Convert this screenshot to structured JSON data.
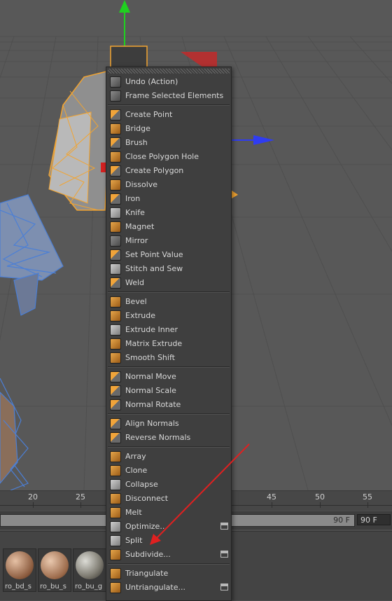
{
  "menu": {
    "groups": [
      [
        {
          "label": "Undo (Action)",
          "icon": "undo-icon",
          "style": "gray"
        },
        {
          "label": "Frame Selected Elements",
          "icon": "frame-selected-icon",
          "style": "gray"
        }
      ],
      [
        {
          "label": "Create Point",
          "icon": "create-point-icon",
          "style": "mix"
        },
        {
          "label": "Bridge",
          "icon": "bridge-icon",
          "style": "orange"
        },
        {
          "label": "Brush",
          "icon": "brush-icon",
          "style": "mix"
        },
        {
          "label": "Close Polygon Hole",
          "icon": "close-polygon-hole-icon",
          "style": "orange"
        },
        {
          "label": "Create Polygon",
          "icon": "create-polygon-icon",
          "style": "mix"
        },
        {
          "label": "Dissolve",
          "icon": "dissolve-icon",
          "style": "orange"
        },
        {
          "label": "Iron",
          "icon": "iron-icon",
          "style": "mix"
        },
        {
          "label": "Knife",
          "icon": "knife-icon",
          "style": "light"
        },
        {
          "label": "Magnet",
          "icon": "magnet-icon",
          "style": "orange"
        },
        {
          "label": "Mirror",
          "icon": "mirror-icon",
          "style": "gray"
        },
        {
          "label": "Set Point Value",
          "icon": "set-point-value-icon",
          "style": "mix"
        },
        {
          "label": "Stitch and Sew",
          "icon": "stitch-and-sew-icon",
          "style": "light"
        },
        {
          "label": "Weld",
          "icon": "weld-icon",
          "style": "mix"
        }
      ],
      [
        {
          "label": "Bevel",
          "icon": "bevel-icon",
          "style": "orange"
        },
        {
          "label": "Extrude",
          "icon": "extrude-icon",
          "style": "orange"
        },
        {
          "label": "Extrude Inner",
          "icon": "extrude-inner-icon",
          "style": "light"
        },
        {
          "label": "Matrix Extrude",
          "icon": "matrix-extrude-icon",
          "style": "orange"
        },
        {
          "label": "Smooth Shift",
          "icon": "smooth-shift-icon",
          "style": "orange"
        }
      ],
      [
        {
          "label": "Normal Move",
          "icon": "normal-move-icon",
          "style": "mix"
        },
        {
          "label": "Normal Scale",
          "icon": "normal-scale-icon",
          "style": "mix"
        },
        {
          "label": "Normal Rotate",
          "icon": "normal-rotate-icon",
          "style": "mix"
        }
      ],
      [
        {
          "label": "Align Normals",
          "icon": "align-normals-icon",
          "style": "mix"
        },
        {
          "label": "Reverse Normals",
          "icon": "reverse-normals-icon",
          "style": "mix"
        }
      ],
      [
        {
          "label": "Array",
          "icon": "array-icon",
          "style": "orange"
        },
        {
          "label": "Clone",
          "icon": "clone-icon",
          "style": "orange"
        },
        {
          "label": "Collapse",
          "icon": "collapse-icon",
          "style": "light"
        },
        {
          "label": "Disconnect",
          "icon": "disconnect-icon",
          "style": "orange"
        },
        {
          "label": "Melt",
          "icon": "melt-icon",
          "style": "orange"
        },
        {
          "label": "Optimize...",
          "icon": "optimize-icon",
          "style": "light",
          "options": true
        },
        {
          "label": "Split",
          "icon": "split-icon",
          "style": "light"
        },
        {
          "label": "Subdivide...",
          "icon": "subdivide-icon",
          "style": "orange",
          "options": true
        }
      ],
      [
        {
          "label": "Triangulate",
          "icon": "triangulate-icon",
          "style": "orange"
        },
        {
          "label": "Untriangulate...",
          "icon": "untriangulate-icon",
          "style": "orange",
          "options": true
        }
      ]
    ]
  },
  "timeline": {
    "ticks": [
      "20",
      "25",
      "45",
      "50",
      "55"
    ],
    "end_frame_label": "90 F",
    "current_frame_field": "90 F"
  },
  "materials": [
    {
      "label": "ro_bd_s"
    },
    {
      "label": "ro_bu_s"
    },
    {
      "label": "ro_bu_g"
    }
  ],
  "colors": {
    "menu_bg": "#3f3f3f",
    "selection_orange": "#f2a431",
    "wireframe_blue": "#4b7fd6",
    "axis_green": "#1fd11f",
    "axis_blue": "#2f3cf2",
    "annotation_red": "#e02020"
  }
}
